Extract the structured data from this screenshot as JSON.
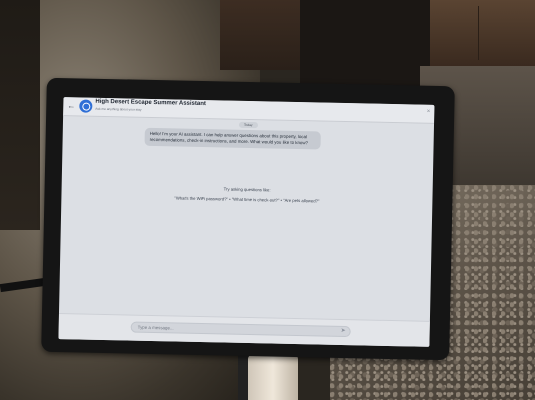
{
  "header": {
    "title": "High Desert Escape Summer Assistant",
    "subtitle": "Ask me anything about your stay"
  },
  "chat": {
    "date_label": "Today",
    "ai_message": "Hello! I'm your AI assistant. I can help answer questions about this property, local recommendations, check-in instructions, and more. What would you like to know?",
    "suggestions_title": "Try asking questions like:",
    "suggestions": "\"What's the WiFi password?\" • \"What time is check-out?\" • \"Are pets allowed?\""
  },
  "composer": {
    "placeholder": "Type a message..."
  },
  "icons": {
    "back": "back-arrow-icon",
    "avatar": "assistant-avatar-icon",
    "close": "close-icon",
    "send": "send-icon"
  },
  "colors": {
    "accent": "#2f6fd6",
    "screen_background": "#dcdfe4",
    "bubble": "#c6cad1"
  }
}
